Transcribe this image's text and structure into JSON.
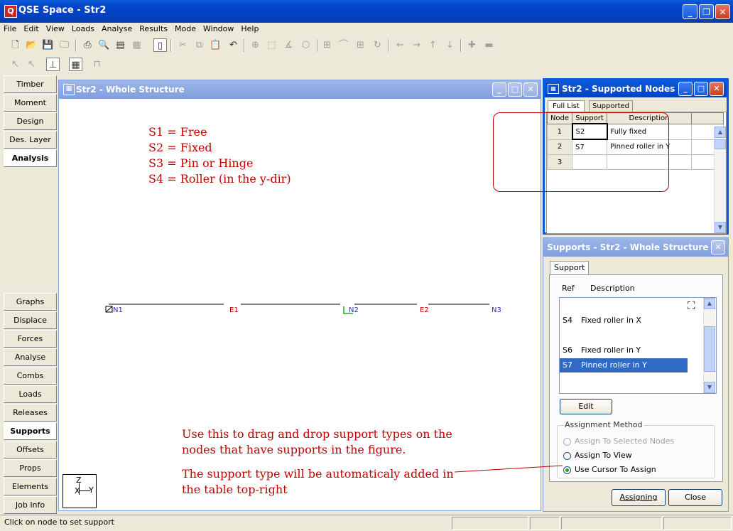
{
  "app": {
    "title": "QSE Space - Str2"
  },
  "menu": [
    "File",
    "Edit",
    "View",
    "Loads",
    "Analyse",
    "Results",
    "Mode",
    "Window",
    "Help"
  ],
  "sidebar_top": [
    {
      "label": "Timber",
      "active": false
    },
    {
      "label": "Moment Con.",
      "active": false
    },
    {
      "label": "Design",
      "active": false
    },
    {
      "label": "Des. Layer",
      "active": false
    },
    {
      "label": "Analysis",
      "active": true
    }
  ],
  "sidebar_bottom": [
    {
      "label": "Graphs",
      "active": false
    },
    {
      "label": "Displace",
      "active": false
    },
    {
      "label": "Forces",
      "active": false
    },
    {
      "label": "Analyse",
      "active": false
    },
    {
      "label": "Combs",
      "active": false
    },
    {
      "label": "Loads",
      "active": false
    },
    {
      "label": "Releases",
      "active": false
    },
    {
      "label": "Supports",
      "active": true
    },
    {
      "label": "Offsets",
      "active": false
    },
    {
      "label": "Props",
      "active": false
    },
    {
      "label": "Elements",
      "active": false
    },
    {
      "label": "Job Info",
      "active": false
    }
  ],
  "structure_window": {
    "title": "Str2 - Whole Structure",
    "legend": [
      "S1 = Free",
      "S2 = Fixed",
      "S3 = Pin or Hinge",
      "S4 = Roller (in the y-dir)"
    ],
    "nodes": [
      "N1",
      "N2",
      "N3"
    ],
    "elements": [
      "E1",
      "E2"
    ],
    "note_line1": "Use this to drag and drop support types on the",
    "note_line2": "nodes that have supports in the figure.",
    "note_line3": "The support  type will be automaticaly added in",
    "note_line4": "the table top-right",
    "axes": {
      "z": "Z",
      "y": "Y",
      "x": "X"
    }
  },
  "supported_nodes": {
    "title": "Str2 - Supported Nodes",
    "tabs": [
      "Full List",
      "Supported"
    ],
    "columns": [
      "Node",
      "Support",
      "Description"
    ],
    "rows": [
      {
        "node": "1",
        "support": "S2",
        "description": "Fully fixed"
      },
      {
        "node": "2",
        "support": "S7",
        "description": "Pinned roller in Y"
      },
      {
        "node": "3",
        "support": "",
        "description": ""
      }
    ]
  },
  "supports_panel": {
    "title": "Supports - Str2 - Whole Structure",
    "tab": "Support",
    "col_ref": "Ref",
    "col_desc": "Description",
    "items": [
      {
        "ref": "S4",
        "description": "Fixed roller in X",
        "selected": false
      },
      {
        "ref": "S6",
        "description": "Fixed roller in Y",
        "selected": false
      },
      {
        "ref": "S7",
        "description": "Pinned roller in Y",
        "selected": true
      }
    ],
    "edit_label": "Edit",
    "method_title": "Assignment Method",
    "methods": [
      {
        "label": "Assign To Selected Nodes",
        "enabled": false,
        "checked": false
      },
      {
        "label": "Assign To View",
        "enabled": true,
        "checked": false
      },
      {
        "label": "Use Cursor To Assign",
        "enabled": true,
        "checked": true
      }
    ],
    "assigning_label": "Assigning",
    "close_label": "Close"
  },
  "status": {
    "text": "Click on node to set support"
  },
  "colors": {
    "accent_red": "#c00000",
    "select_blue": "#316ac5",
    "support_green": "#22aa22"
  }
}
